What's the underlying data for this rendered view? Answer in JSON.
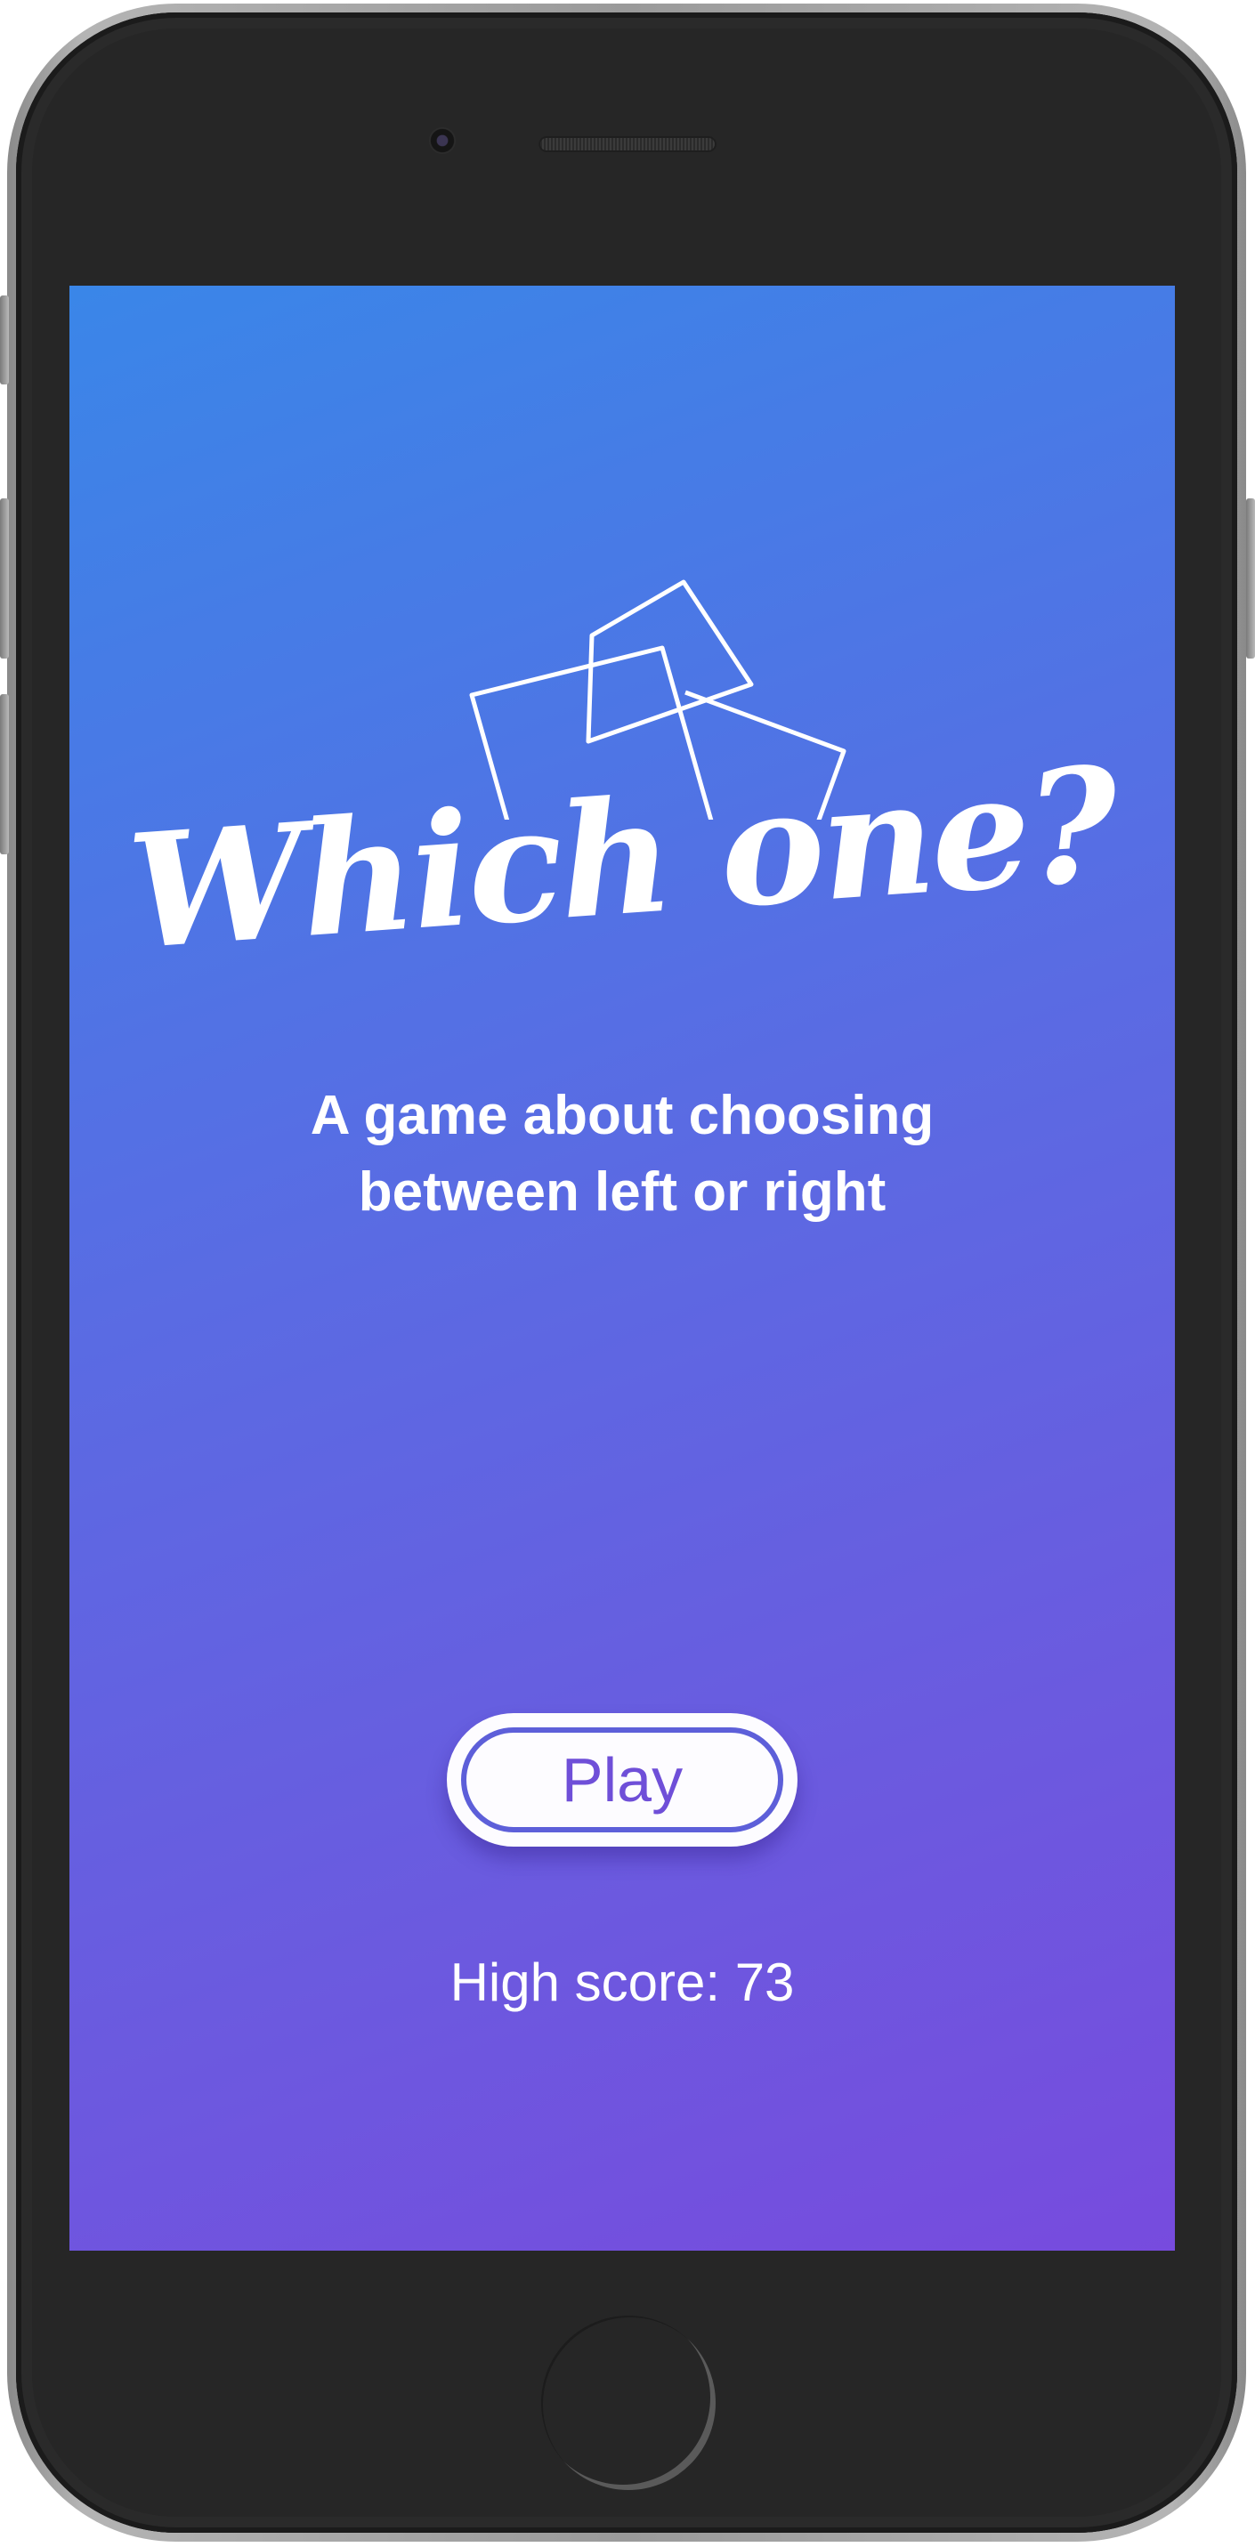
{
  "app": {
    "title": "Which one?",
    "subtitle": "A game about choosing\nbetween left or right",
    "play_label": "Play",
    "high_score_label": "High score: 73"
  },
  "icons": {
    "logo": "two-overlapping-cards-icon",
    "camera": "front-camera-icon",
    "speaker": "earpiece-speaker-icon",
    "home": "home-button-icon"
  },
  "colors": {
    "gradient_start": "#3a86e8",
    "gradient_end": "#774bde",
    "button_text": "#6f4fd8",
    "button_border": "#5d5fd9",
    "text": "#ffffff"
  }
}
